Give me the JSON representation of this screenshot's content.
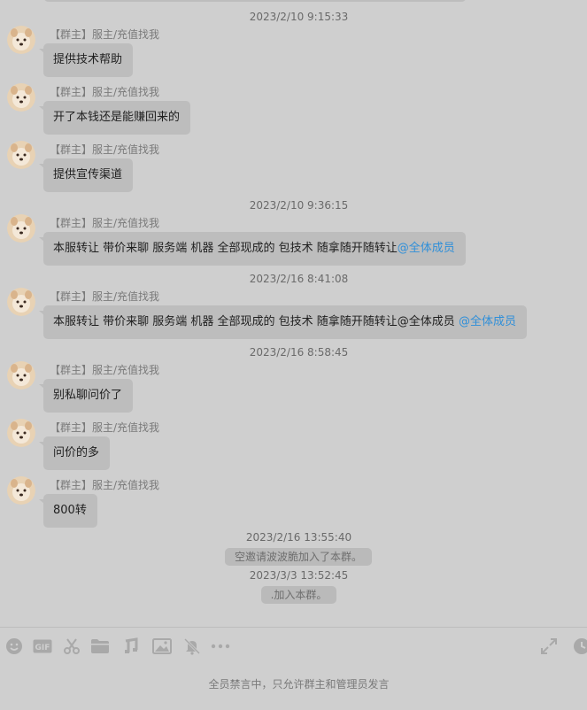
{
  "sender": {
    "name": "【群主】服主/充值找我"
  },
  "timestamps": [
    "2023/2/10 9:15:33",
    "2023/2/10 9:36:15",
    "2023/2/16 8:41:08",
    "2023/2/16 8:58:45",
    "2023/2/16 13:55:40",
    "2023/3/3 13:52:45"
  ],
  "messages": [
    {
      "text": "提供技术帮助"
    },
    {
      "text": "开了本钱还是能赚回来的"
    },
    {
      "text": "提供宣传渠道"
    },
    {
      "text": "本服转让 带价来聊 服务端 机器 全部现成的 包技术 随拿随开随转让",
      "mention": "@全体成员"
    },
    {
      "text": "本服转让 带价来聊 服务端 机器 全部现成的 包技术 随拿随开随转让@全体成员 ",
      "mention": "@全体成员"
    },
    {
      "text": "别私聊问价了"
    },
    {
      "text": "问价的多"
    },
    {
      "text": "800转"
    }
  ],
  "system": [
    "空邀请波波脆加入了本群。",
    ".加入本群。"
  ],
  "toolbar": {
    "icons": [
      "emoji-icon",
      "gif-icon",
      "scissors-icon",
      "folder-icon",
      "music-icon",
      "image-icon",
      "bell-off-icon",
      "more-icon",
      "expand-icon",
      "history-icon"
    ]
  },
  "notice": "全员禁言中，只允许群主和管理员发言",
  "colors": {
    "background": "#cfcfcf",
    "bubble": "#bdbdbd",
    "mention": "#2f8fd9"
  }
}
